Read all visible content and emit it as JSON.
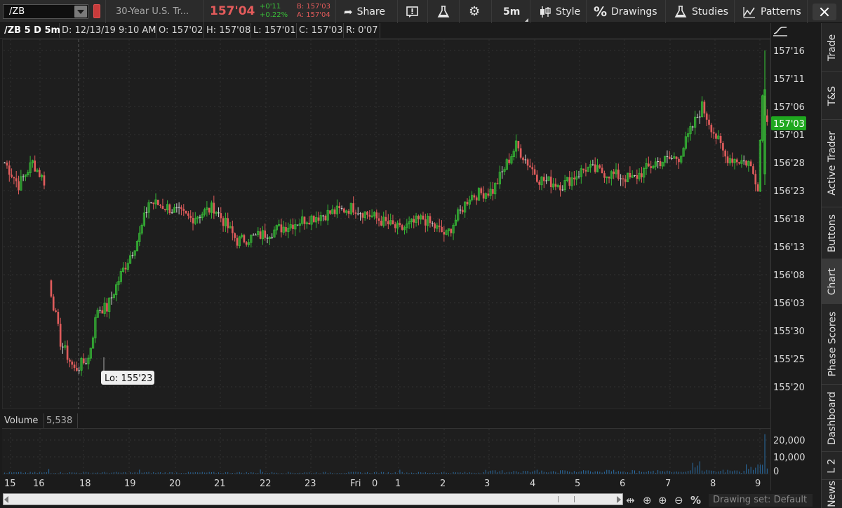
{
  "toolbar": {
    "symbol": "/ZB",
    "description": "30-Year U.S. Tr...",
    "last_price": "157'04",
    "net_change": "+0'11",
    "pct_change": "+0.22%",
    "bid": "B: 157'03",
    "ask": "A: 157'04",
    "share_label": "Share",
    "timeframe_label": "5m",
    "style_label": "Style",
    "drawings_label": "Drawings",
    "studies_label": "Studies",
    "patterns_label": "Patterns",
    "colors": {
      "price": "#e45b5b",
      "change": "#39c239"
    }
  },
  "infobar": {
    "chart_title": "/ZB 5 D 5m",
    "date": "D: 12/13/19 9:10 AM",
    "open": "O: 157'02",
    "high": "H: 157'08",
    "low": "L: 157'01",
    "close": "C: 157'03",
    "range": "R: 0'07"
  },
  "volume": {
    "label": "Volume",
    "value": "5,538"
  },
  "sidebar": {
    "tabs": [
      "Trade",
      "T&S",
      "Active Trader",
      "Buttons",
      "Chart",
      "Phase Scores",
      "Dashboard",
      "L 2",
      "News"
    ],
    "active": "Chart"
  },
  "bottombar": {
    "drawing_set": "Drawing set: Default"
  },
  "chart_data": {
    "type": "candlestick",
    "title": "/ZB 5 D 5m",
    "y_axis_ticks": [
      "157'16",
      "157'11",
      "157'06",
      "157'01",
      "156'28",
      "156'23",
      "156'18",
      "156'13",
      "156'08",
      "156'03",
      "155'30",
      "155'25",
      "155'20"
    ],
    "y_axis_ticks_32nds": [
      5040,
      5035,
      5030,
      5025,
      5020,
      5015,
      5010,
      5005,
      5000,
      4995,
      4990,
      4985,
      4980
    ],
    "ylim_32nds": [
      4976,
      5042
    ],
    "current_price_label": "157'03",
    "current_price_32nds": 5027,
    "low_annotation": "Lo: 155'23",
    "low_annotation_32nds": 4983,
    "x_axis_labels": [
      "15",
      "16",
      "18",
      "19",
      "20",
      "21",
      "22",
      "23",
      "Fri",
      "0",
      "1",
      "2",
      "3",
      "4",
      "5",
      "6",
      "7",
      "8",
      "9"
    ],
    "session_anchors_32nds": [
      [
        0,
        5020
      ],
      [
        6,
        5016
      ],
      [
        12,
        5020
      ],
      [
        18,
        5016
      ],
      [
        19,
        4999
      ],
      [
        24,
        4988
      ],
      [
        30,
        4983
      ],
      [
        36,
        4985
      ],
      [
        40,
        4994
      ],
      [
        44,
        4994
      ],
      [
        50,
        5000
      ],
      [
        58,
        5007
      ],
      [
        62,
        5013
      ],
      [
        70,
        5012
      ],
      [
        80,
        5010
      ],
      [
        90,
        5012
      ],
      [
        100,
        5006
      ],
      [
        110,
        5007
      ],
      [
        130,
        5010
      ],
      [
        150,
        5012
      ],
      [
        170,
        5008
      ],
      [
        180,
        5010
      ],
      [
        190,
        5007
      ],
      [
        200,
        5014
      ],
      [
        210,
        5015
      ],
      [
        220,
        5023
      ],
      [
        230,
        5017
      ],
      [
        240,
        5016
      ],
      [
        250,
        5019
      ],
      [
        260,
        5018
      ],
      [
        270,
        5017
      ],
      [
        280,
        5020
      ],
      [
        290,
        5021
      ],
      [
        300,
        5030
      ],
      [
        310,
        5021
      ],
      [
        320,
        5020
      ],
      [
        324,
        5016
      ],
      [
        326,
        5032
      ],
      [
        328,
        5027
      ]
    ],
    "volume": {
      "ylim": [
        0,
        25000
      ],
      "ticks": [
        "20,000",
        "10,000",
        "0"
      ],
      "ticks_values": [
        20000,
        10000,
        0
      ],
      "spike_value": 23500
    },
    "colors": {
      "up": "#35b535",
      "down": "#e05c5c",
      "flat": "#d0d0d0",
      "volume": "#2a6fa8",
      "price_marker": "#1fa81f"
    }
  }
}
